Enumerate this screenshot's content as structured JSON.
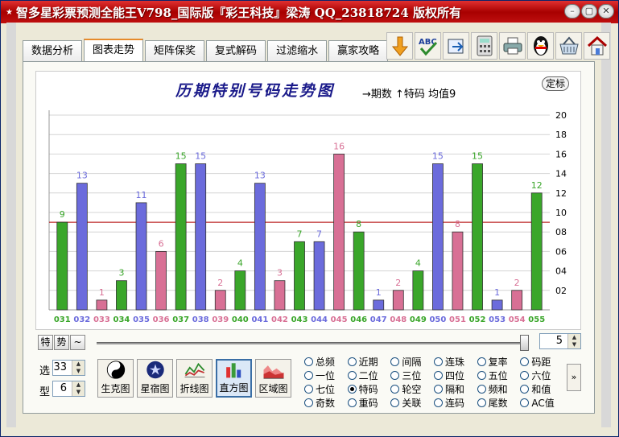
{
  "window": {
    "title": "智多星彩票预测全能王V798_国际版『彩王科技』梁涛 QQ_23818724 版权所有"
  },
  "tabs": [
    "数据分析",
    "图表走势",
    "矩阵保奖",
    "复式解码",
    "过滤缩水",
    "赢家攻略"
  ],
  "active_tab": "图表走势",
  "toolbar_icons": [
    "down-arrow-icon",
    "spellcheck-icon",
    "export-icon",
    "calculator-icon",
    "printer-icon",
    "qq-penguin-icon",
    "basket-icon",
    "home-icon"
  ],
  "chart": {
    "title": "历期特别号码走势图",
    "legend": "→期数 ↑特码 均值9",
    "calibrate_label": "定标"
  },
  "chart_data": {
    "type": "bar",
    "categories": [
      "031",
      "032",
      "033",
      "034",
      "035",
      "036",
      "037",
      "038",
      "039",
      "040",
      "041",
      "042",
      "043",
      "044",
      "045",
      "046",
      "047",
      "048",
      "049",
      "050",
      "051",
      "052",
      "053",
      "054",
      "055"
    ],
    "values": [
      9,
      13,
      1,
      3,
      11,
      6,
      15,
      15,
      2,
      4,
      13,
      3,
      7,
      7,
      16,
      8,
      1,
      2,
      4,
      15,
      8,
      15,
      1,
      2,
      12
    ],
    "colors": [
      "#3aa62a",
      "#6b6bdc",
      "#d87095",
      "#3aa62a",
      "#6b6bdc",
      "#d87095",
      "#3aa62a",
      "#6b6bdc",
      "#d87095",
      "#3aa62a",
      "#6b6bdc",
      "#d87095",
      "#3aa62a",
      "#6b6bdc",
      "#d87095",
      "#3aa62a",
      "#6b6bdc",
      "#d87095",
      "#3aa62a",
      "#6b6bdc",
      "#d87095",
      "#3aa62a",
      "#6b6bdc",
      "#d87095",
      "#3aa62a"
    ],
    "yticks": [
      "02",
      "04",
      "06",
      "08",
      "10",
      "12",
      "14",
      "16",
      "18",
      "20"
    ],
    "ylim": [
      0,
      20
    ],
    "mean": 9,
    "mean_color": "#b00000",
    "grid": true
  },
  "controls": {
    "mode_buttons": [
      "特",
      "势",
      "~"
    ],
    "slider_value": "5",
    "xuan_label": "选",
    "xuan_value": "33",
    "xing_label": "型",
    "xing_value": "6"
  },
  "chart_types": [
    "生克图",
    "星宿图",
    "折线图",
    "直方图",
    "区域图"
  ],
  "active_chart_type": "直方图",
  "radio_options": [
    "总频",
    "近期",
    "间隔",
    "连珠",
    "复率",
    "码距",
    "一位",
    "二位",
    "三位",
    "四位",
    "五位",
    "六位",
    "七位",
    "特码",
    "轮空",
    "隔和",
    "频和",
    "和值",
    "奇数",
    "重码",
    "关联",
    "连码",
    "尾数",
    "AC值"
  ],
  "radio_selected": "特码",
  "more_label": "»"
}
